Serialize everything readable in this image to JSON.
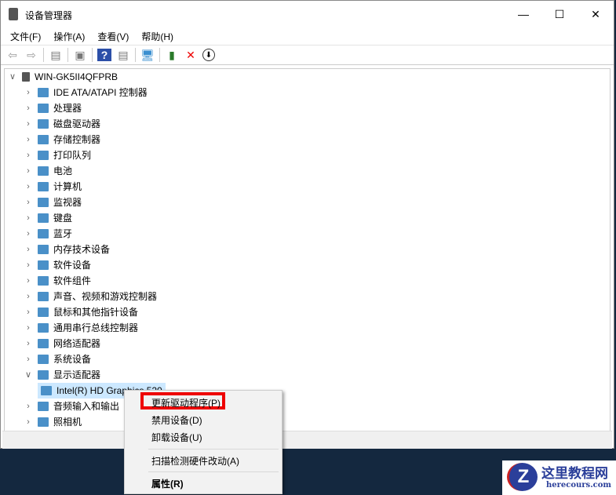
{
  "window": {
    "title": "设备管理器",
    "minimize": "—",
    "maximize": "☐",
    "close": "✕"
  },
  "menu": [
    "文件(F)",
    "操作(A)",
    "查看(V)",
    "帮助(H)"
  ],
  "tree": {
    "root": "WIN-GK5II4QFPRB",
    "items": [
      {
        "label": "IDE ATA/ATAPI 控制器",
        "expanded": false
      },
      {
        "label": "处理器",
        "expanded": false
      },
      {
        "label": "磁盘驱动器",
        "expanded": false
      },
      {
        "label": "存储控制器",
        "expanded": false
      },
      {
        "label": "打印队列",
        "expanded": false
      },
      {
        "label": "电池",
        "expanded": false
      },
      {
        "label": "计算机",
        "expanded": false
      },
      {
        "label": "监视器",
        "expanded": false
      },
      {
        "label": "键盘",
        "expanded": false
      },
      {
        "label": "蓝牙",
        "expanded": false
      },
      {
        "label": "内存技术设备",
        "expanded": false
      },
      {
        "label": "软件设备",
        "expanded": false
      },
      {
        "label": "软件组件",
        "expanded": false
      },
      {
        "label": "声音、视频和游戏控制器",
        "expanded": false
      },
      {
        "label": "鼠标和其他指针设备",
        "expanded": false
      },
      {
        "label": "通用串行总线控制器",
        "expanded": false
      },
      {
        "label": "网络适配器",
        "expanded": false
      },
      {
        "label": "系统设备",
        "expanded": false
      },
      {
        "label": "显示适配器",
        "expanded": true
      },
      {
        "label": "Intel(R) HD Graphics 520",
        "child": true,
        "selected": true
      },
      {
        "label": "音频输入和输出",
        "expanded": false
      },
      {
        "label": "照相机",
        "expanded": false
      }
    ]
  },
  "context_menu": {
    "items": [
      "更新驱动程序(P)",
      "禁用设备(D)",
      "卸载设备(U)",
      "扫描检测硬件改动(A)",
      "属性(R)"
    ],
    "highlighted": "更新驱动程序(P)"
  },
  "watermark": {
    "title": "这里教程网",
    "url": "herecours.com"
  },
  "colors": {
    "highlight": "#e00000",
    "selection": "#cce8ff"
  }
}
